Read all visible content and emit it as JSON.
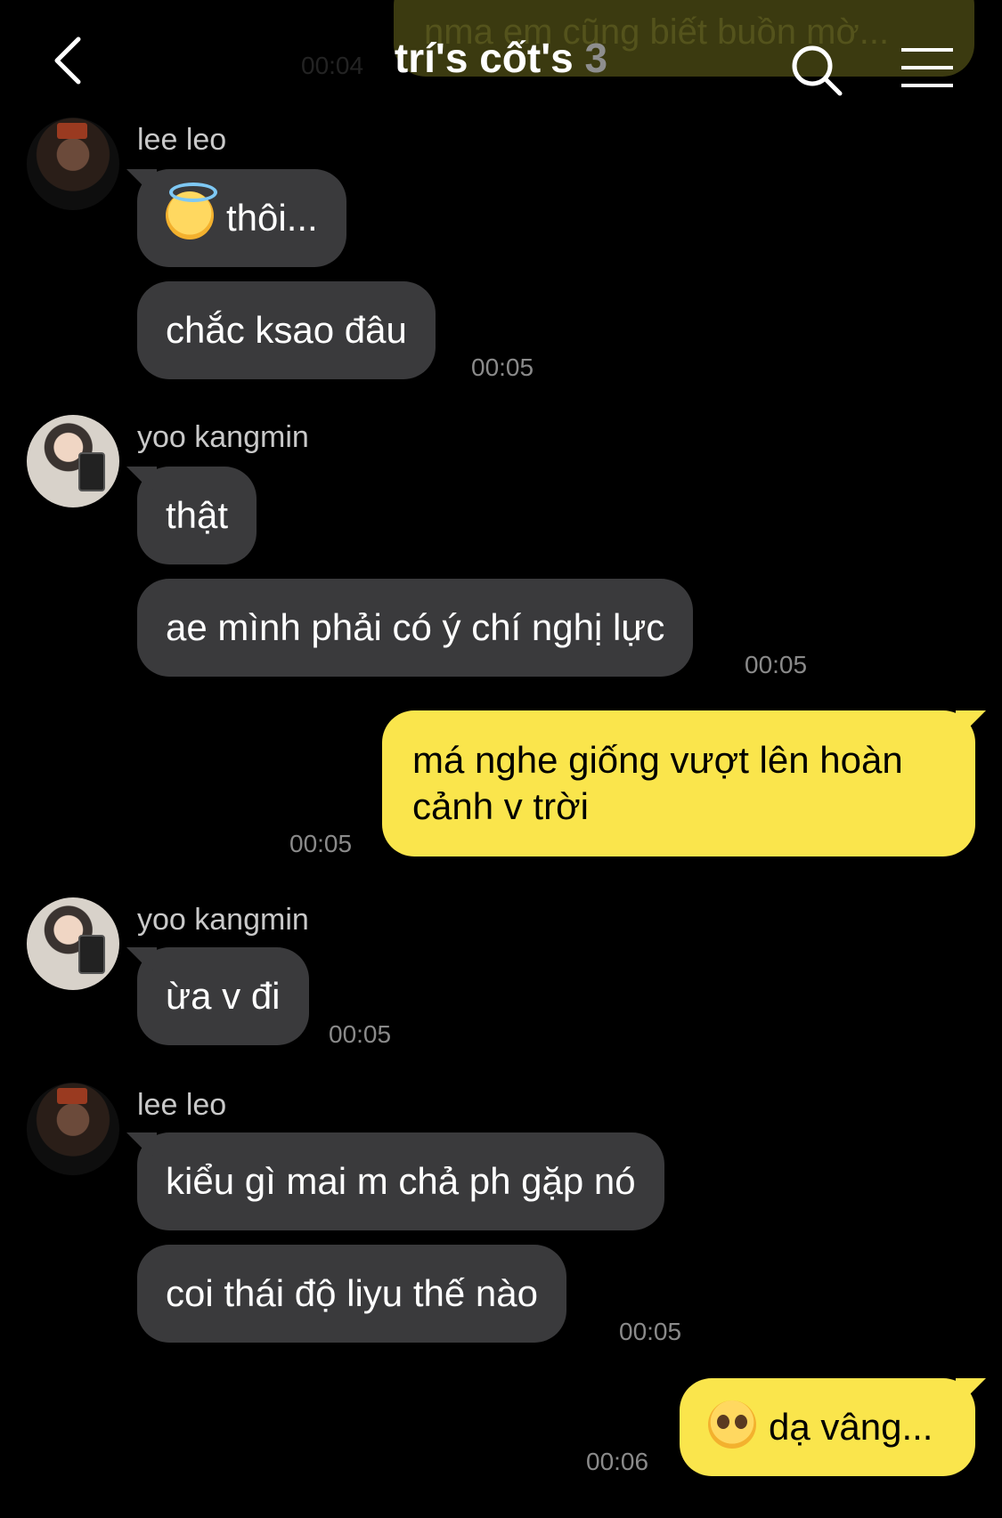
{
  "header": {
    "title": "trí's cốt's",
    "member_count": "3"
  },
  "ghost": {
    "text": "nma em cũng biết buồn mờ...",
    "time": "00:04"
  },
  "messages": [
    {
      "sender": "lee leo",
      "bubbles": [
        {
          "text": "thôi...",
          "emoji": "smiling-face-with-halo"
        },
        {
          "text": "chắc ksao đâu"
        }
      ],
      "time": "00:05"
    },
    {
      "sender": "yoo kangmin",
      "bubbles": [
        {
          "text": "thật"
        },
        {
          "text": "ae mình phải có ý chí nghị lực"
        }
      ],
      "time": "00:05"
    },
    {
      "sender": "me",
      "bubbles": [
        {
          "text": "má nghe giống vượt lên hoàn cảnh v trời"
        }
      ],
      "time": "00:05"
    },
    {
      "sender": "yoo kangmin",
      "bubbles": [
        {
          "text": "ừa v đi"
        }
      ],
      "time": "00:05"
    },
    {
      "sender": "lee leo",
      "bubbles": [
        {
          "text": "kiểu gì mai m chả ph gặp nó"
        },
        {
          "text": "coi thái độ liyu thế nào"
        }
      ],
      "time": "00:05"
    },
    {
      "sender": "me",
      "bubbles": [
        {
          "text": "dạ vâng...",
          "emoji": "pleading-face"
        }
      ],
      "time": "00:06"
    }
  ],
  "colors": {
    "background": "#000000",
    "incoming_bubble": "#3a3a3c",
    "outgoing_bubble": "#fae54c"
  },
  "icons": [
    "back-arrow-icon",
    "search-icon",
    "menu-icon"
  ]
}
